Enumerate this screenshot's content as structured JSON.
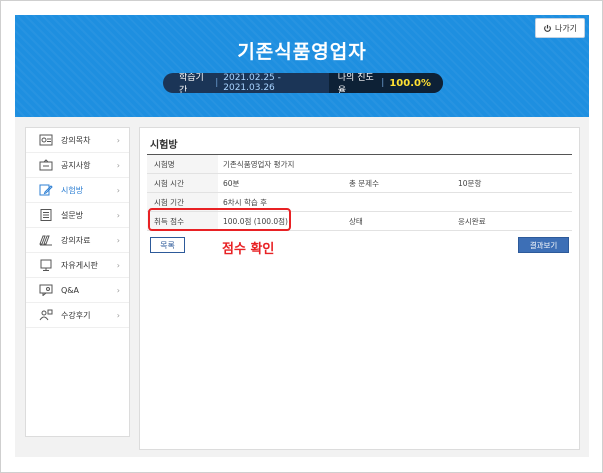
{
  "header": {
    "exit_label": "나가기",
    "title": "기존식품영업자",
    "study_period_label": "학습기간",
    "study_period": "2021.02.25 - 2021.03.26",
    "progress_label": "나의 진도율",
    "progress_value": "100.0%"
  },
  "sidebar": {
    "items": [
      {
        "label": "강의목차",
        "icon": "book-list-icon"
      },
      {
        "label": "공지사항",
        "icon": "notice-icon"
      },
      {
        "label": "시험방",
        "icon": "exam-edit-icon"
      },
      {
        "label": "설문방",
        "icon": "survey-icon"
      },
      {
        "label": "강의자료",
        "icon": "folder-icon"
      },
      {
        "label": "자유게시판",
        "icon": "board-icon"
      },
      {
        "label": "Q&A",
        "icon": "qa-icon"
      },
      {
        "label": "수강후기",
        "icon": "review-icon"
      }
    ]
  },
  "main": {
    "title": "시험방",
    "rows": {
      "exam_name_label": "시험명",
      "exam_name": "기존식품영업자 평가지",
      "exam_time_label": "시험 시간",
      "exam_time": "60분",
      "total_questions_label": "총 문제수",
      "total_questions": "10문항",
      "exam_period_label": "시험 기간",
      "exam_period": "6차시 학습 후",
      "score_label": "취득 점수",
      "score": "100.0점 (100.0점)",
      "status_label": "상태",
      "status": "응시완료"
    },
    "list_button": "목록",
    "result_button": "결과보기",
    "annotation": "점수 확인"
  },
  "colors": {
    "header_bg": "#1e8fe0",
    "highlight": "#e82124",
    "active_menu": "#2d7fd3",
    "progress_value": "#ffe033"
  }
}
